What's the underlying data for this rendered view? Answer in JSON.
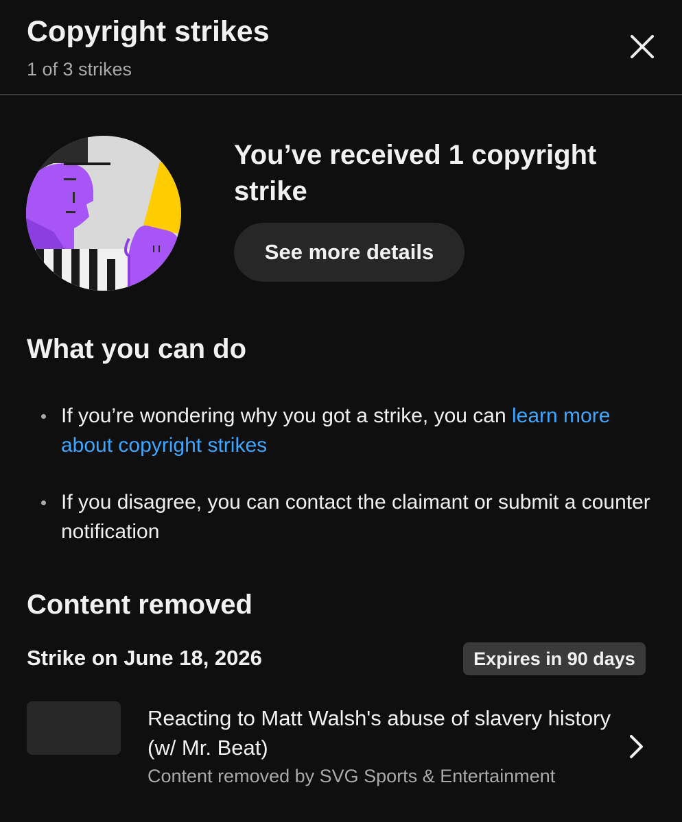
{
  "header": {
    "title": "Copyright strikes",
    "subtitle": "1 of 3 strikes",
    "close_icon": "close-icon"
  },
  "summary": {
    "heading": "You’ve received 1 copyright strike",
    "details_button": "See more details",
    "illustration": "referee-yellow-card-illustration"
  },
  "what_you_can_do": {
    "heading": "What you can do",
    "items": [
      {
        "text": "If you’re wondering why you got a strike, you can ",
        "link": "learn more about copyright strikes"
      },
      {
        "text": "If you disagree, you can contact the claimant or submit a counter notification"
      }
    ]
  },
  "content_removed": {
    "heading": "Content removed",
    "strike_date": "Strike on June 18, 2026",
    "expires": "Expires in 90 days",
    "video": {
      "title": "Reacting to Matt Walsh's abuse of slavery history (w/ Mr. Beat)",
      "subtitle": "Content removed by SVG Sports & Entertainment",
      "chevron_icon": "chevron-right-icon"
    }
  },
  "colors": {
    "background": "#0f0f0f",
    "text": "#f1f1f1",
    "secondary_text": "#aaaaaa",
    "link": "#3ea6ff",
    "button_bg": "#272727",
    "badge_bg": "#3a3a3a",
    "card_yellow": "#ffcc00",
    "skin_purple": "#a855f7"
  }
}
